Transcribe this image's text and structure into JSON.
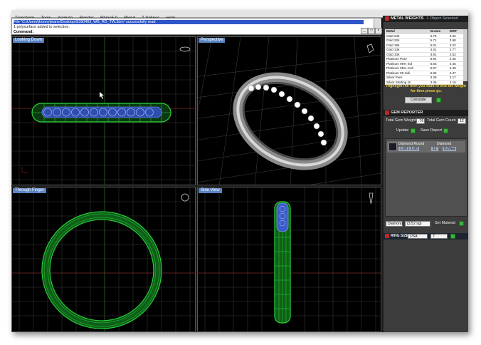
{
  "menu": [
    "Transform",
    "Tools",
    "Analyze",
    "Render",
    "Rhino5.0",
    "Blend",
    "T-Splines",
    "Help"
  ],
  "command": {
    "line1": "File \"C:\\Users\\jhonny\\jeans\\Desktop\\S390463_WB_RD_TW.3dm\" successfully read",
    "line2": "1 polysurface added to selection.",
    "line3": "Command:"
  },
  "viewports": {
    "top": "Looking Down",
    "perspective": "Perspective",
    "front": "Through Finger",
    "right": "Side View"
  },
  "metal_weights": {
    "title": "METAL WEIGHTS",
    "subtitle": "1 Object Selected",
    "columns": [
      "Metal",
      "Grams",
      "DWT"
    ],
    "rows": [
      [
        "Gold 24k",
        "6.75",
        "4.02"
      ],
      [
        "Gold 22k",
        "5.71",
        "3.68"
      ],
      [
        "Gold 18k",
        "5.01",
        "3.22"
      ],
      [
        "Gold 14k",
        "4.31",
        "2.77"
      ],
      [
        "Gold 10k",
        "3.91",
        "2.52"
      ],
      [
        "Platinum Pure",
        "6.94",
        "4.46"
      ],
      [
        "Platinum 95% Ind",
        "6.93",
        "4.45"
      ],
      [
        "Platinum 95% Cob",
        "6.97",
        "4.49"
      ],
      [
        "Platinum 95 Iridi",
        "6.96",
        "4.47"
      ],
      [
        "Silver Pure",
        "3.38",
        "2.17"
      ],
      [
        "Silver Sterling (S",
        "3.36",
        "2.16"
      ]
    ],
    "hint": "Highlight the item you want to find the weight for then press go.",
    "calculate_label": "Calculate"
  },
  "gem_reporter": {
    "title": "GEM REPORTER",
    "total_weight_label": "Total Gem Weight",
    "total_weight_value": ".76",
    "total_count_label": "Total Gem Count",
    "total_count_value": "12",
    "update_label": "Update",
    "save_report_label": "Save Report",
    "gem_name": "Diamond Round",
    "gem_type": "Diamond",
    "gem_size": "1.90 x 1.90",
    "gem_qty": "12",
    "gem_weight": "0.29ea",
    "material_select": "Diamond",
    "material_weight": "(3.52 sg)",
    "set_material_label": "Set Material"
  },
  "ring_size": {
    "label": "RING SIZE",
    "region": "USA",
    "value": "7"
  },
  "colors": {
    "ring_green": "#2bd23b",
    "gem_blue": "#7a9cff",
    "grid": "#3a3a3a",
    "accent_title": "#5a84c4"
  }
}
